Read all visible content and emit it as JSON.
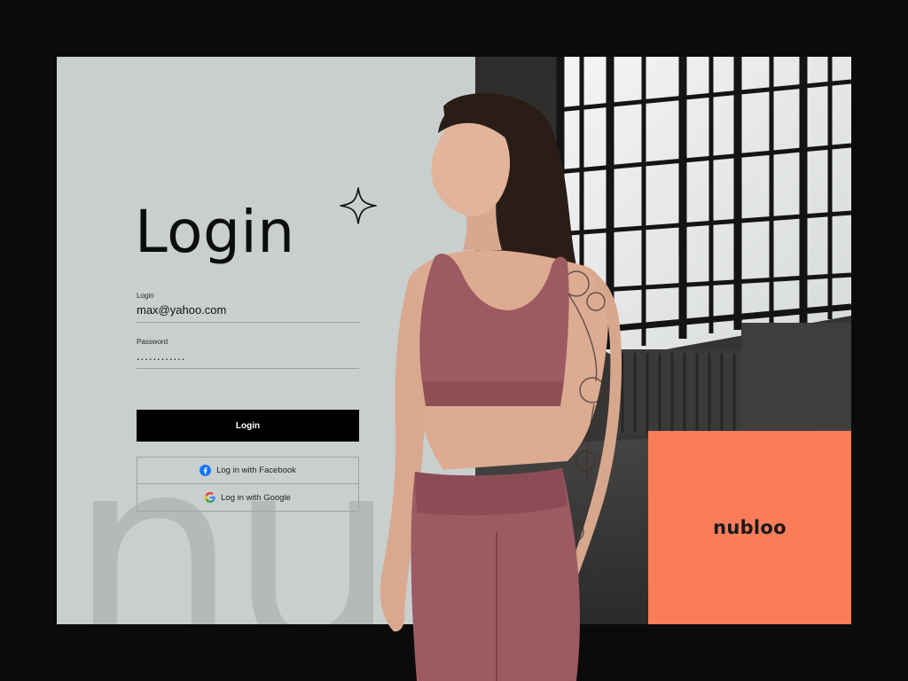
{
  "login_panel": {
    "title": "Login",
    "watermark": "nu",
    "email_label": "Login",
    "email_value": "max@yahoo.com",
    "password_label": "Password",
    "password_value": "............",
    "submit_label": "Login",
    "facebook_label": "Log in with Facebook",
    "google_label": "Log in with Google"
  },
  "brand": {
    "name": "nubloo",
    "color": "#fa7d5a"
  },
  "icons": {
    "sparkle": "sparkle-icon",
    "facebook": "facebook-icon",
    "google": "google-icon"
  },
  "colors": {
    "panel_background": "#c9cfce",
    "page_background": "#0b0b0b",
    "button_background": "#000000",
    "outfit": "#9c5a62"
  }
}
